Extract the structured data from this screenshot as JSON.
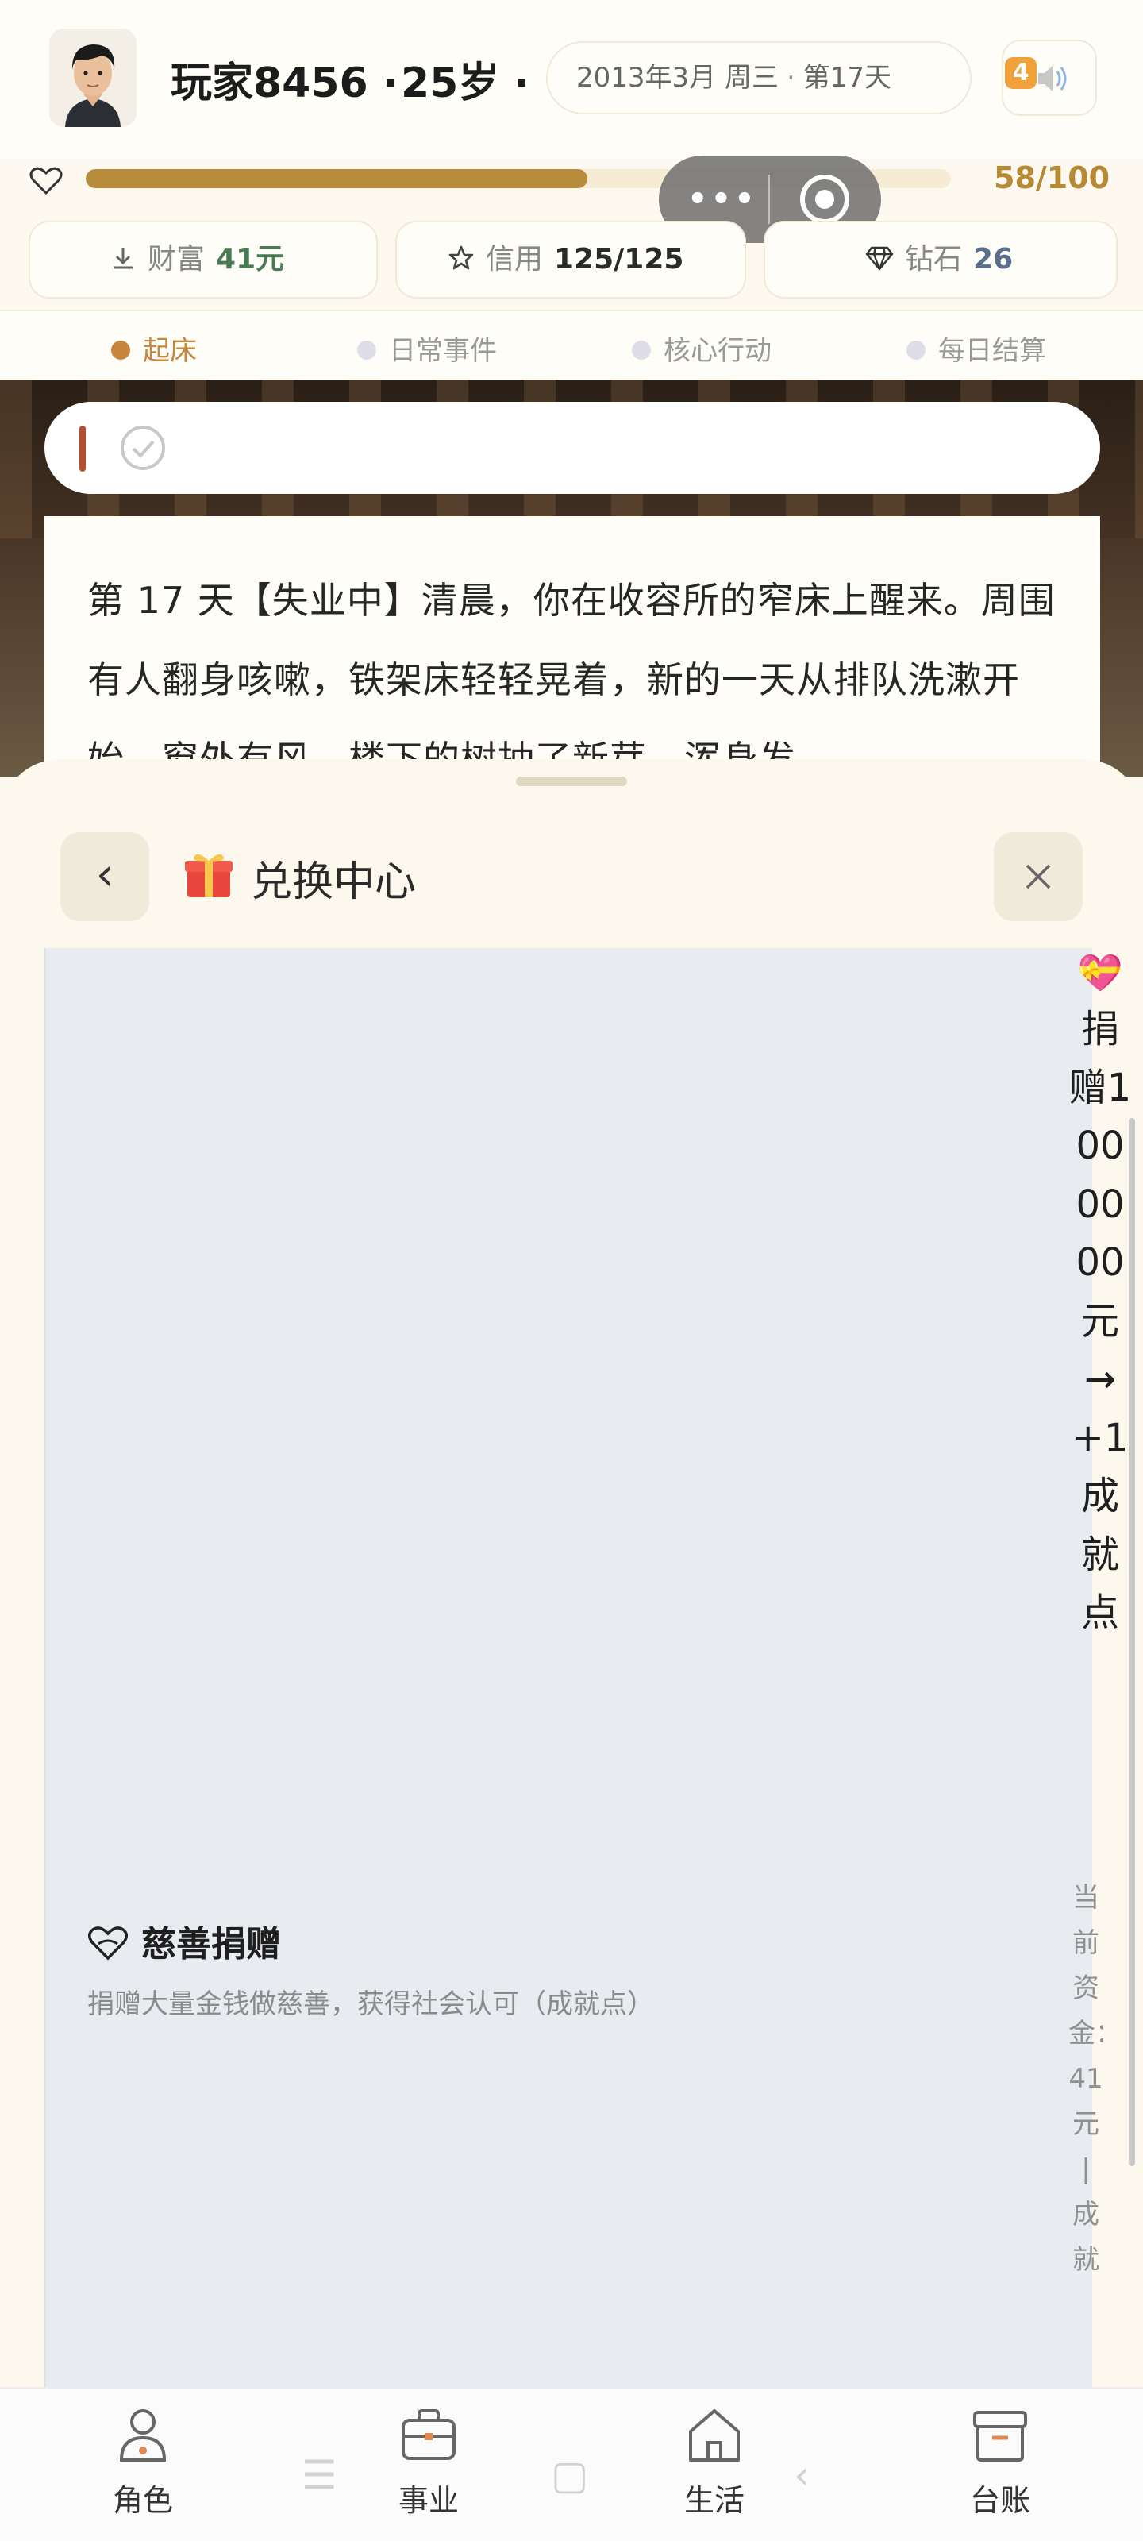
{
  "header": {
    "player_name": "玩家8456 ·",
    "age": "25岁 ·",
    "date": "2013年3月 周三",
    "date_sep": "·",
    "day": "第17天",
    "level_badge": "4"
  },
  "progress": {
    "value": 58,
    "max": 100,
    "label": "58/100"
  },
  "stats": {
    "wealth": {
      "label": "财富",
      "value": "41元"
    },
    "credit": {
      "label": "信用",
      "value": "125/125"
    },
    "diamond": {
      "label": "钻石",
      "value": "26"
    }
  },
  "phases": [
    {
      "label": "起床",
      "active": true
    },
    {
      "label": "日常事件",
      "active": false
    },
    {
      "label": "核心行动",
      "active": false
    },
    {
      "label": "每日结算",
      "active": false
    }
  ],
  "story": {
    "text": "第 17 天【失业中】清晨，你在收容所的窄床上醒来。周围有人翻身咳嗽，铁架床轻轻晃着，新的一天从排队洗漱开始。窗外有风，楼下的树抽了新芽，浑身发"
  },
  "sheet": {
    "title": "兑换中心",
    "back_label": "‹",
    "close_label": "✕",
    "charity": {
      "title": "慈善捐赠",
      "description": "捐赠大量金钱做慈善，获得社会认可（成就点）",
      "action": "捐赠1000000元→+1成就点",
      "sub": "当前资金：41元 | 成就"
    }
  },
  "nav": [
    {
      "label": "角色"
    },
    {
      "label": "事业"
    },
    {
      "label": "生活"
    },
    {
      "label": "台账"
    }
  ],
  "colors": {
    "accent": "#c7853d",
    "progress": "#b98c3b",
    "wealth": "#4a7a54",
    "diamond": "#5a6f8c",
    "story_marker": "#b24e33"
  },
  "icons": {
    "avatar": "avatar-portrait",
    "sound": "speaker-icon",
    "heart": "heart-icon",
    "wealth": "download-arrow-icon",
    "credit": "star-icon",
    "diamond": "diamond-icon",
    "gift": "gift-icon",
    "charity": "heart-hand-icon"
  }
}
